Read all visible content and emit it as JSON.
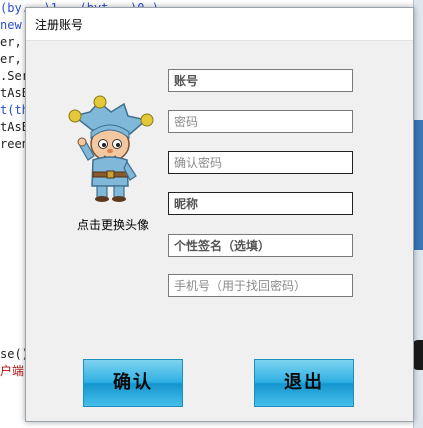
{
  "background_editor": {
    "lines": [
      "(by...)1...(byt...)0.)",
      "new",
      "er,",
      "er,",
      ".Ser",
      "tAsE",
      "t(th",
      "tAsE",
      "reen",
      "se()",
      "户端"
    ]
  },
  "dialog": {
    "title": "注册账号",
    "avatar_caption": "点击更换头像",
    "fields": {
      "account_placeholder": "账号",
      "password_placeholder": "密码",
      "confirm_password_placeholder": "确认密码",
      "nickname_placeholder": "昵称",
      "signature_placeholder": "个性签名（选填）",
      "phone_placeholder": "手机号（用于找回密码）"
    },
    "buttons": {
      "confirm": "确认",
      "exit": "退出"
    }
  },
  "colors": {
    "button_gradient_top": "#7fd3f0",
    "button_gradient_bottom": "#1595cf",
    "dialog_bg": "#f0f0f0"
  },
  "icons": {
    "avatar": "jester-cartoon-avatar-icon"
  }
}
